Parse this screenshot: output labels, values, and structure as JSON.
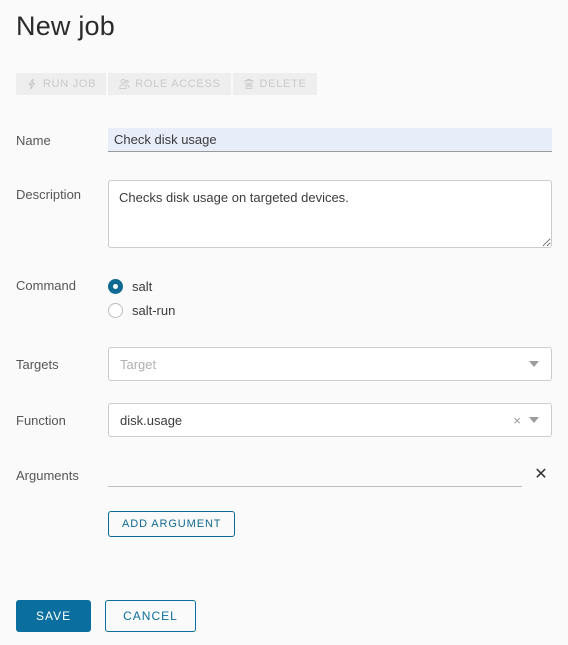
{
  "page": {
    "title": "New job",
    "background_color": "#fafafa",
    "accent_color": "#0a6e9e",
    "radio_color": "#0f6a92"
  },
  "toolbar": {
    "buttons": [
      {
        "label": "RUN JOB",
        "icon": "lightning-bolt-icon",
        "disabled": true
      },
      {
        "label": "ROLE ACCESS",
        "icon": "users-group-icon",
        "disabled": true
      },
      {
        "label": "DELETE",
        "icon": "trash-icon",
        "disabled": true
      }
    ]
  },
  "form": {
    "name": {
      "label": "Name",
      "value": "Check disk usage",
      "placeholder": "",
      "background_color": "#e8edfa"
    },
    "description": {
      "label": "Description",
      "value": "Checks disk usage on targeted devices.",
      "placeholder": ""
    },
    "command": {
      "label": "Command",
      "selected": "salt",
      "options": [
        {
          "label": "salt",
          "checked": true
        },
        {
          "label": "salt-run",
          "checked": false
        }
      ]
    },
    "targets": {
      "label": "Targets",
      "value": "",
      "placeholder": "Target",
      "caret_icon": "chevron-down-icon"
    },
    "function": {
      "label": "Function",
      "value": "disk.usage",
      "clear_icon": "clear-x-icon",
      "caret_icon": "chevron-down-icon"
    },
    "arguments": {
      "label": "Arguments",
      "value": "",
      "placeholder": "",
      "remove_icon": "close-x-icon"
    },
    "add_argument_label": "ADD ARGUMENT"
  },
  "actions": {
    "save_label": "SAVE",
    "cancel_label": "CANCEL"
  }
}
